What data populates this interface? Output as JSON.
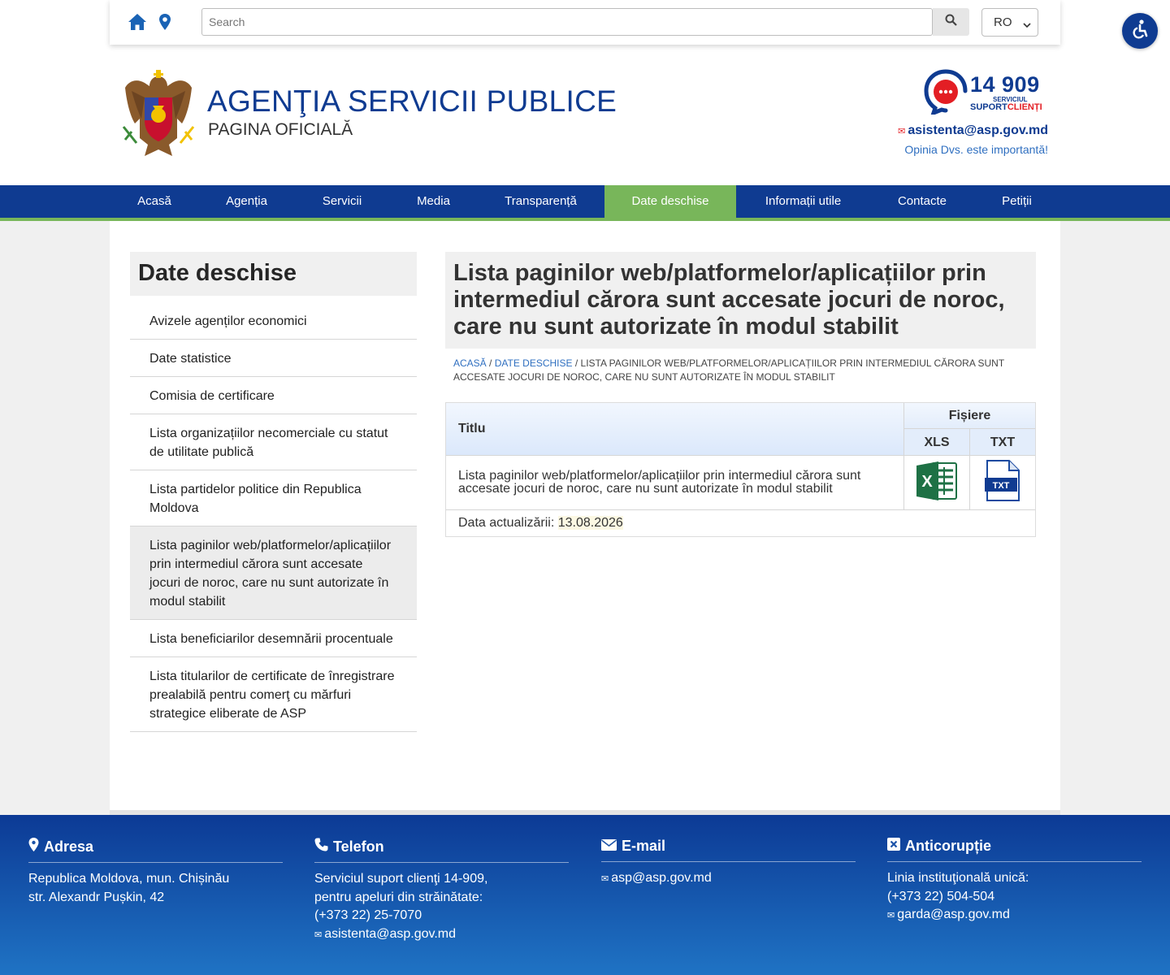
{
  "topbar": {
    "search_placeholder": "Search",
    "language": "RO"
  },
  "header": {
    "title": "AGENŢIA SERVICII PUBLICE",
    "subtitle": "PAGINA OFICIALĂ",
    "hotline_number": "14 909",
    "hotline_label_1": "SERVICIUL",
    "hotline_label_2a": "SUPORT",
    "hotline_label_2b": "CLIENȚI",
    "email": "asistenta@asp.gov.md",
    "opinion": "Opinia Dvs. este importantă!"
  },
  "nav": {
    "items": [
      "Acasă",
      "Agenția",
      "Servicii",
      "Media",
      "Transparență",
      "Date deschise",
      "Informații utile",
      "Contacte",
      "Petiții"
    ],
    "active": "Date deschise"
  },
  "sidebar": {
    "heading": "Date deschise",
    "items": [
      "Avizele agenților economici",
      "Date statistice",
      "Comisia de certificare",
      "Lista organizațiilor necomerciale cu statut de utilitate publică",
      "Lista partidelor politice din Republica Moldova",
      "Lista paginilor web/platformelor/aplicațiilor prin intermediul cărora sunt accesate jocuri de noroc, care nu sunt autorizate în modul stabilit",
      "Lista beneficiarilor desemnării procentuale",
      "Lista titularilor de certificate de înregistrare prealabilă pentru comerţ cu mărfuri strategice eliberate de ASP"
    ]
  },
  "page": {
    "title": "Lista paginilor web/platformelor/aplicațiilor prin intermediul cărora sunt accesate jocuri de noroc, care nu sunt autorizate în modul stabilit",
    "breadcrumb_home": "Acasă",
    "breadcrumb_section": "Date deschise",
    "breadcrumb_sep": " / ",
    "breadcrumb_current": "Lista paginilor web/platformelor/aplicațiilor prin intermediul cărora sunt accesate jocuri de noroc, care nu sunt autorizate în modul stabilit"
  },
  "table": {
    "col_title": "Titlu",
    "col_files": "Fișiere",
    "col_xls": "XLS",
    "col_txt": "TXT",
    "row_title": "Lista paginilor web/platformelor/aplicațiilor prin intermediul cărora sunt accesate jocuri de noroc, care nu sunt autorizate în modul stabilit",
    "txt_icon_label": "TXT",
    "xls_icon_label": "X",
    "updated_label": "Data actualizării:",
    "updated_value": "13.08.2026"
  },
  "footer": {
    "address": {
      "heading": "Adresa",
      "lines": [
        "Republica Moldova, mun. Chișinău",
        "str. Alexandr Pușkin, 42"
      ]
    },
    "phone": {
      "heading": "Telefon",
      "lines": [
        "Serviciul suport clienţi 14-909,",
        "pentru apeluri din străinătate:",
        "(+373 22) 25-7070"
      ],
      "email": "asistenta@asp.gov.md"
    },
    "email": {
      "heading": "E-mail",
      "email": "asp@asp.gov.md"
    },
    "anticorruption": {
      "heading": "Anticorupție",
      "lines": [
        "Linia instituţională unică:",
        "(+373 22) 504-504"
      ],
      "email": "garda@asp.gov.md"
    }
  },
  "colors": {
    "brand_blue": "#0f3b91",
    "accent_green": "#78b65a",
    "link_blue": "#2f6fc0",
    "hotline_red": "#e31e24"
  },
  "icons": {
    "home": "home-icon",
    "location": "map-pin-icon",
    "search": "search-icon",
    "accessibility": "accessibility-icon",
    "emblem": "coat-of-arms-icon",
    "hotline": "headset-phone-icon",
    "envelope": "envelope-icon",
    "excel": "excel-file-icon",
    "txt": "txt-file-icon",
    "phone": "phone-icon",
    "anticorruption": "close-square-icon"
  }
}
